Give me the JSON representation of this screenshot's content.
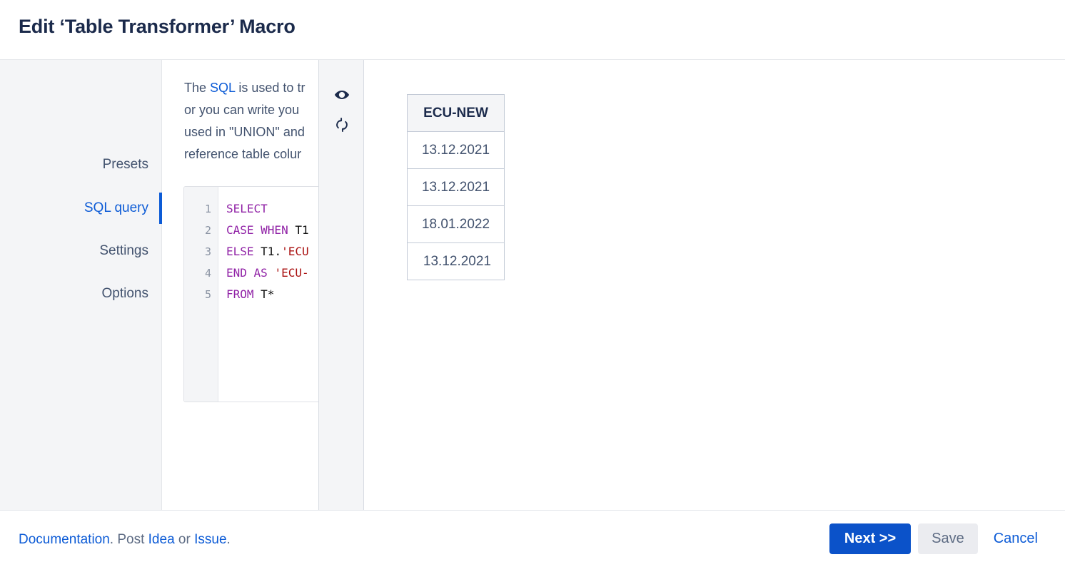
{
  "header": {
    "title": "Edit ‘Table Transformer’ Macro"
  },
  "sidebar": {
    "items": [
      {
        "label": "Presets",
        "active": false
      },
      {
        "label": "SQL query",
        "active": true
      },
      {
        "label": "Settings",
        "active": false
      },
      {
        "label": "Options",
        "active": false
      }
    ]
  },
  "description": {
    "line1_a": "The ",
    "line1_link": "SQL",
    "line1_b": " is used to tr",
    "line2": "or you can write you",
    "line3": "used in \"UNION\" and",
    "line4": "reference table colur"
  },
  "editor": {
    "line_numbers": [
      "1",
      "2",
      "3",
      "4",
      "5"
    ],
    "lines": [
      {
        "kw": "SELECT",
        "id": "",
        "str": ""
      },
      {
        "kw": "CASE WHEN ",
        "id": "T1",
        "str": ""
      },
      {
        "kw": "ELSE ",
        "id": "T1.",
        "str": "'ECU"
      },
      {
        "kw": "END AS ",
        "id": "",
        "str": "'ECU-"
      },
      {
        "kw": "FROM ",
        "id": "T*",
        "str": ""
      }
    ]
  },
  "icon_rail": {
    "preview_tooltip": "Preview",
    "refresh_tooltip": "Refresh"
  },
  "preview": {
    "table": {
      "columns": [
        "ECU-NEW"
      ],
      "rows": [
        [
          "13.12.2021"
        ],
        [
          "13.12.2021"
        ],
        [
          "18.01.2022"
        ],
        [
          "13.12.2021"
        ]
      ]
    }
  },
  "footer": {
    "doc_link": "Documentation",
    "sep1": ". Post ",
    "idea_link": "Idea",
    "sep2": " or ",
    "issue_link": "Issue",
    "sep3": ".",
    "next_label": "Next >>",
    "save_label": "Save",
    "cancel_label": "Cancel"
  },
  "colors": {
    "accent": "#0c5bd6",
    "primary_button": "#0b52c9",
    "title": "#1b2a4b",
    "panel_bg": "#f4f5f7",
    "keyword": "#9021a6",
    "string": "#aa1111"
  }
}
